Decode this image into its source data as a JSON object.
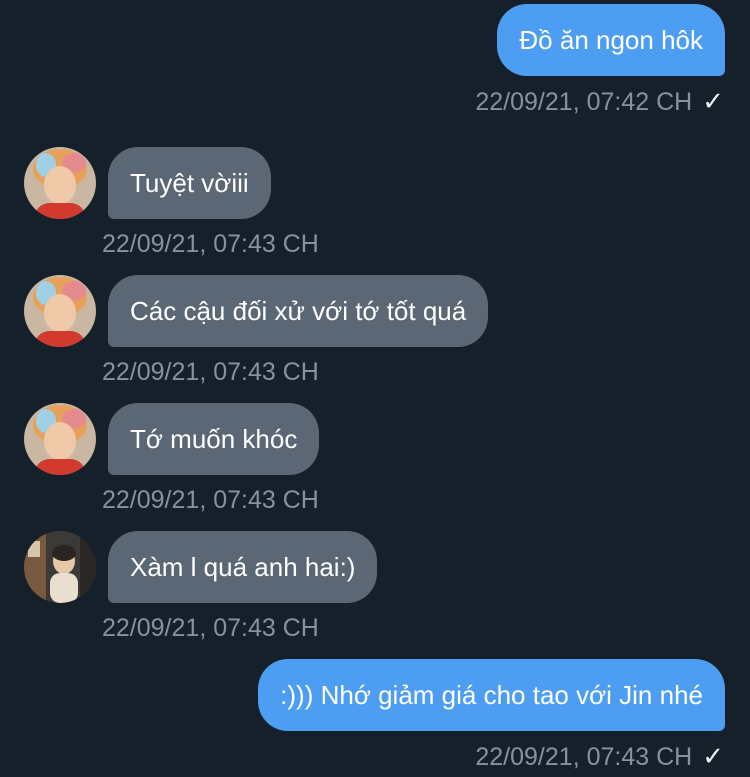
{
  "messages": [
    {
      "text": "Đồ ăn ngon hôk",
      "time": "22/09/21, 07:42 CH",
      "check": "✓"
    },
    {
      "text": "Tuyệt vờiii",
      "time": "22/09/21, 07:43 CH"
    },
    {
      "text": "Các cậu đối xử với tớ tốt quá",
      "time": "22/09/21, 07:43 CH"
    },
    {
      "text": "Tớ muốn khóc",
      "time": "22/09/21, 07:43 CH"
    },
    {
      "text": "Xàm l quá anh hai:)",
      "time": "22/09/21, 07:43 CH"
    },
    {
      "text": ":))) Nhớ giảm giá cho tao với Jin nhé",
      "time": "22/09/21, 07:43 CH",
      "check": "✓"
    }
  ],
  "icons": {
    "read_receipt": "checkmark-icon",
    "avatar_a": "avatar-photo-orange-hair",
    "avatar_b": "avatar-photo-room"
  },
  "colors": {
    "background": "#16202b",
    "outgoing_bubble": "#4d9ef2",
    "incoming_bubble": "#5b6775",
    "timestamp": "#8592a1"
  }
}
